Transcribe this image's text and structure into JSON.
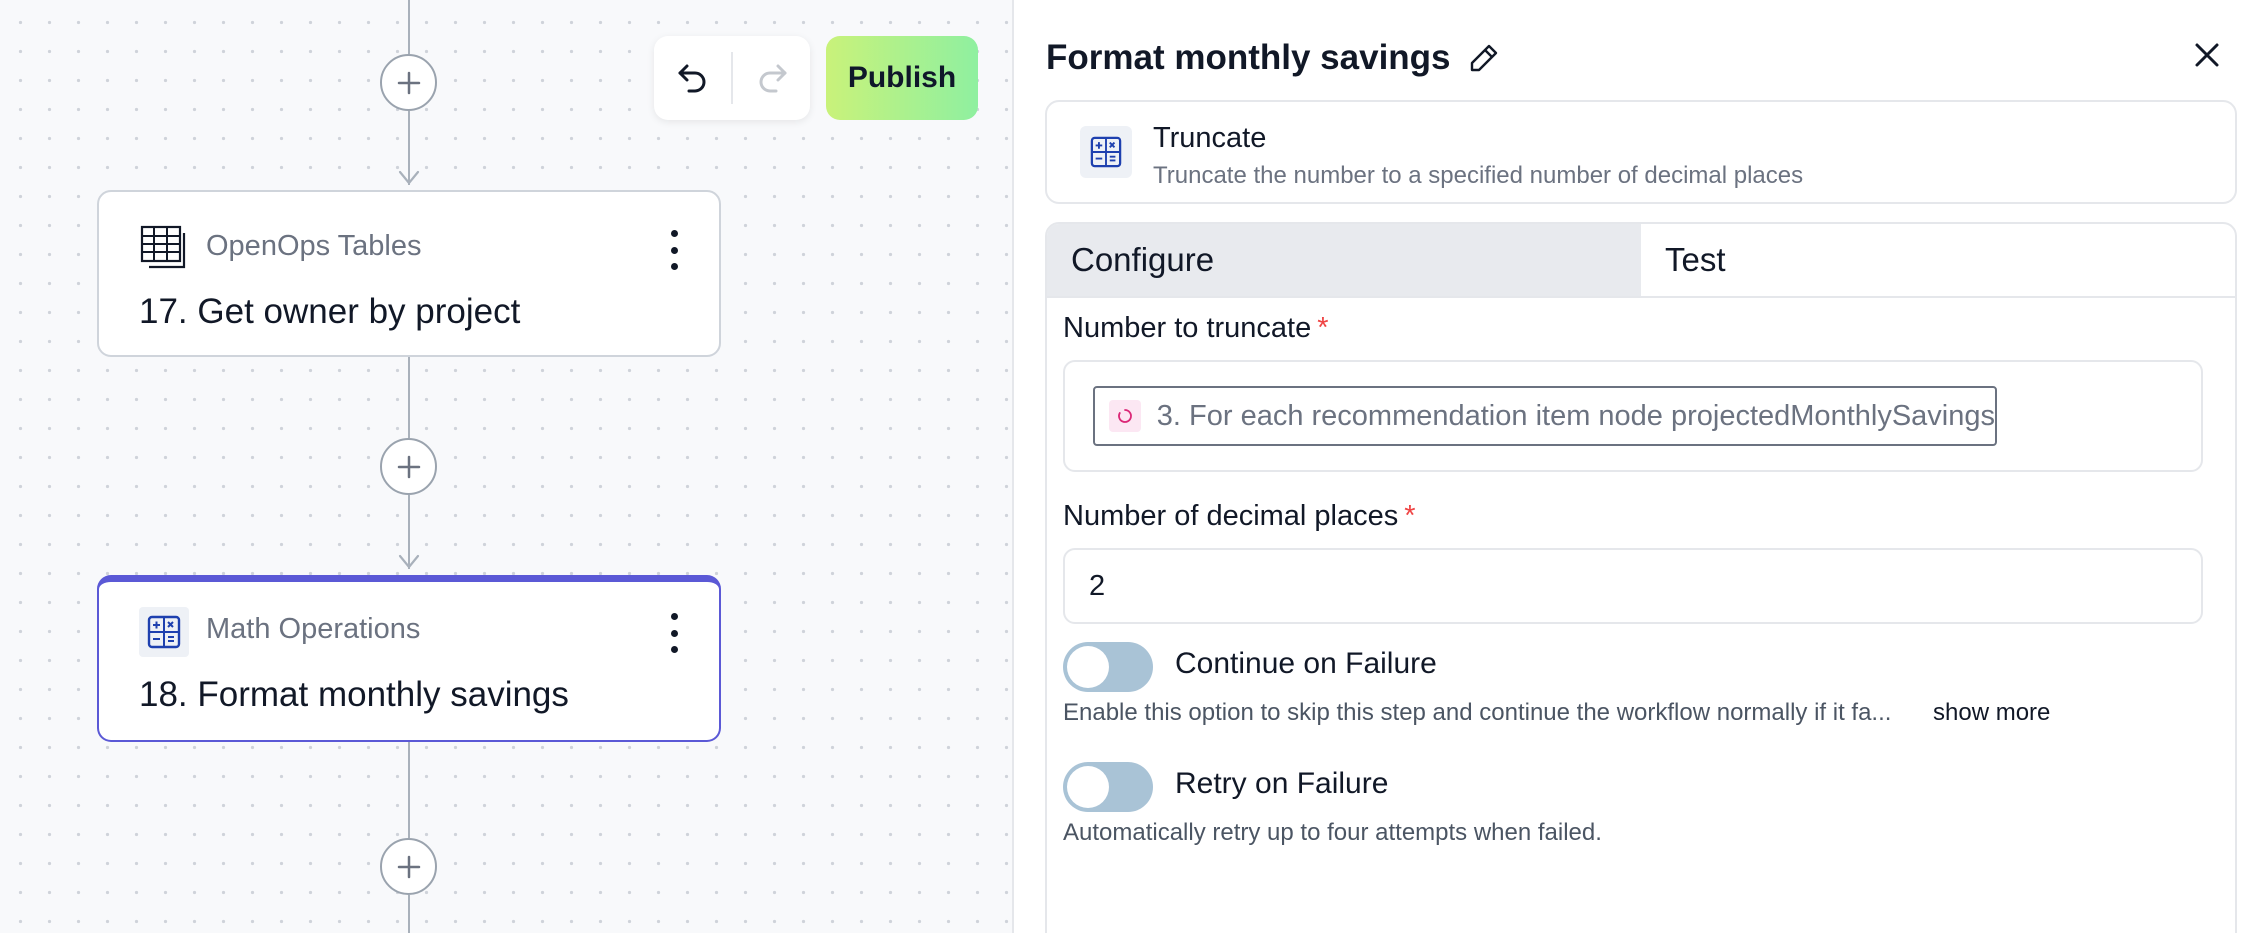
{
  "canvas": {
    "steps": [
      {
        "number_title": "17. Get owner by project",
        "source": "OpenOps Tables",
        "icon": "table-icon"
      },
      {
        "number_title": "18. Format monthly savings",
        "source": "Math Operations",
        "icon": "calculator-icon"
      }
    ],
    "toolbar": {
      "undo_icon": "undo-icon",
      "redo_icon": "redo-icon",
      "publish_label": "Publish"
    }
  },
  "panel": {
    "title": "Format monthly savings",
    "action": {
      "name": "Truncate",
      "description": "Truncate the number to a specified number of decimal places"
    },
    "tabs": [
      "Configure",
      "Test"
    ],
    "selected_tab": "Configure",
    "fields": {
      "number_to_truncate": {
        "label": "Number to truncate",
        "required_mark": "*",
        "value": "3. For each recommendation item node projectedMonthlySavings"
      },
      "decimal_places": {
        "label": "Number of decimal places",
        "required_mark": "*",
        "value": "2"
      }
    },
    "continue_on_failure": {
      "label": "Continue on Failure",
      "enabled": false,
      "help": "Enable this option to skip this step and continue the workflow normally if it fa...",
      "show_more": "show more"
    },
    "retry_on_failure": {
      "label": "Retry on Failure",
      "enabled": false,
      "help": "Automatically retry up to four attempts when failed."
    }
  },
  "colors": {
    "accent": "#5b59d6",
    "publish_gradient_start": "#c9f27a",
    "publish_gradient_end": "#8ff0a0",
    "toggle_off": "#a9c3d6",
    "required": "#ef4444"
  }
}
